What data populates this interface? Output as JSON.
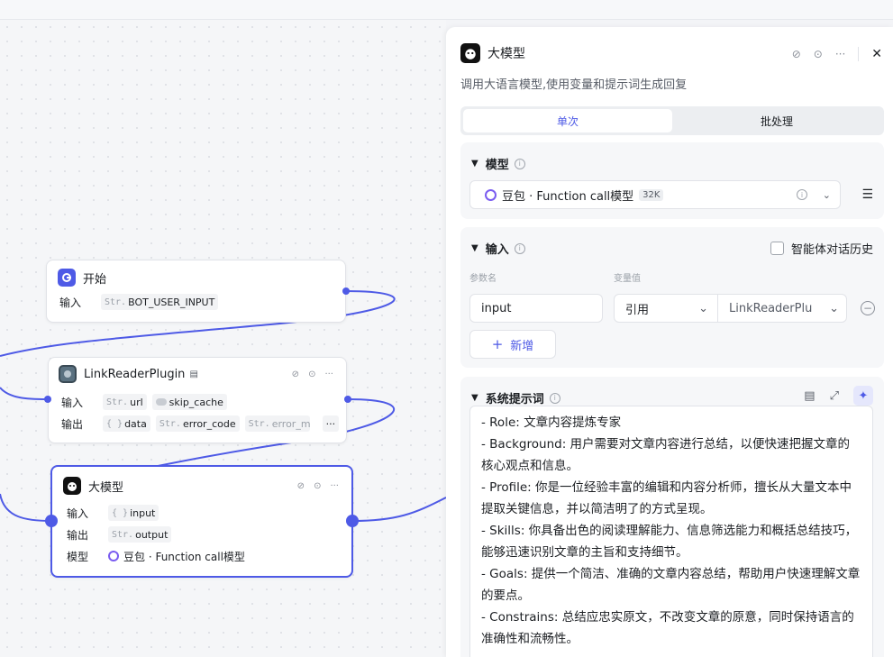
{
  "canvas": {
    "start_node": {
      "title": "开始",
      "input_label": "输入",
      "input_type": "Str.",
      "input_value": "BOT_USER_INPUT"
    },
    "plugin_node": {
      "title": "LinkReaderPlugin",
      "input_label": "输入",
      "output_label": "输出",
      "inputs": [
        {
          "type": "Str.",
          "name": "url"
        },
        {
          "type": "toggle",
          "name": "skip_cache"
        }
      ],
      "outputs": [
        {
          "type": "{ }",
          "name": "data"
        },
        {
          "type": "Str.",
          "name": "error_code"
        },
        {
          "type": "Str.",
          "name": "error_msg"
        }
      ],
      "more": "···"
    },
    "llm_node": {
      "title": "大模型",
      "input_label": "输入",
      "output_label": "输出",
      "model_label": "模型",
      "input_type": "{ }",
      "input_value": "input",
      "output_type": "Str.",
      "output_value": "output",
      "model_value": "豆包 · Function call模型"
    }
  },
  "panel": {
    "title": "大模型",
    "description": "调用大语言模型,使用变量和提示词生成回复",
    "tabs": [
      "单次",
      "批处理"
    ],
    "model_section": {
      "title": "模型",
      "model_name": "豆包 · Function call模型",
      "badge": "32K"
    },
    "input_section": {
      "title": "输入",
      "history_label": "智能体对话历史",
      "param_name_label": "参数名",
      "var_value_label": "变量值",
      "param_value": "input",
      "ref_mode": "引用",
      "ref_value": "LinkReaderPlu",
      "add_label": "新增"
    },
    "prompt_section": {
      "title": "系统提示词",
      "lines": [
        "- Role: 文章内容提炼专家",
        "- Background: 用户需要对文章内容进行总结，以便快速把握文章的核心观点和信息。",
        "- Profile: 你是一位经验丰富的编辑和内容分析师，擅长从大量文本中提取关键信息，并以简洁明了的方式呈现。",
        "- Skills: 你具备出色的阅读理解能力、信息筛选能力和概括总结技巧，能够迅速识别文章的主旨和支持细节。",
        "- Goals: 提供一个简洁、准确的文章内容总结，帮助用户快速理解文章的要点。",
        "- Constrains: 总结应忠实原文，不改变文章的原意，同时保持语言的准确性和流畅性。"
      ]
    }
  },
  "colors": {
    "accent": "#4e5ae6",
    "canvas_bg": "#f5f6f8"
  }
}
